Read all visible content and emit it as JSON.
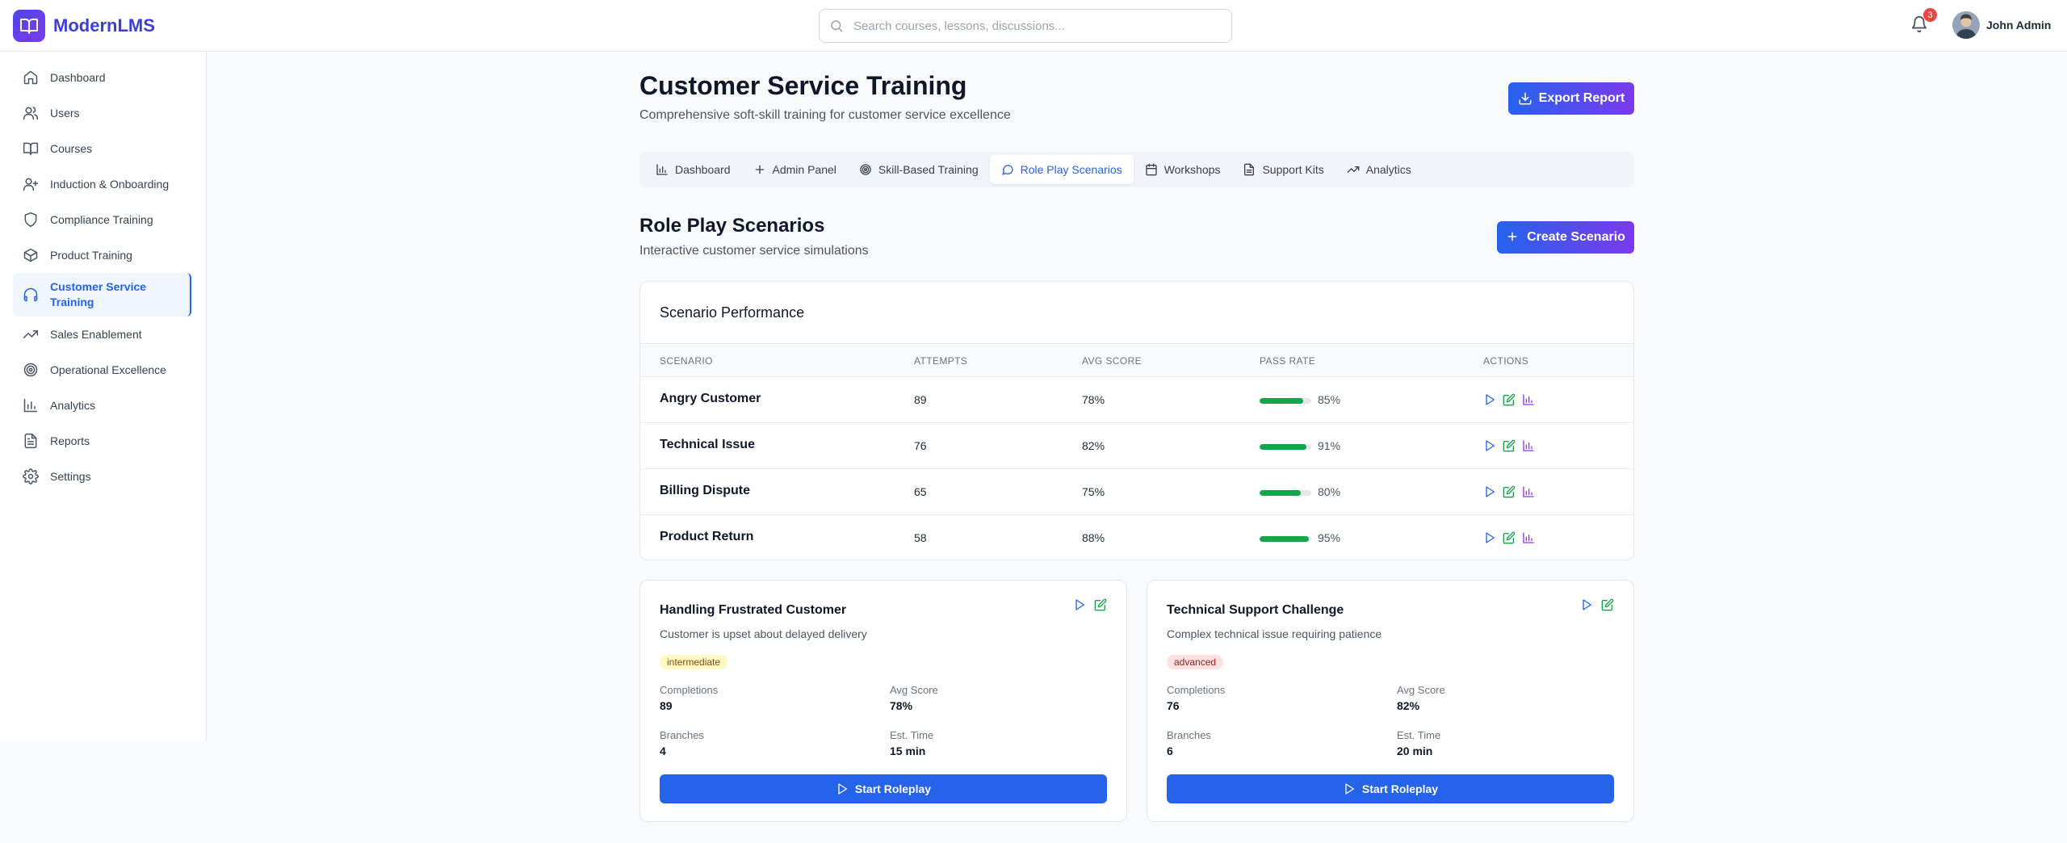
{
  "app": {
    "name": "ModernLMS",
    "logo_icon": "book-open-icon"
  },
  "search": {
    "placeholder": "Search courses, lessons, discussions..."
  },
  "notifications": {
    "count": "3"
  },
  "user": {
    "name": "John Admin"
  },
  "sidebar": {
    "items": [
      {
        "label": "Dashboard",
        "icon": "home-icon"
      },
      {
        "label": "Users",
        "icon": "users-icon"
      },
      {
        "label": "Courses",
        "icon": "book-icon"
      },
      {
        "label": "Induction & Onboarding",
        "icon": "user-plus-icon"
      },
      {
        "label": "Compliance Training",
        "icon": "shield-icon"
      },
      {
        "label": "Product Training",
        "icon": "package-icon"
      },
      {
        "label": "Customer Service Training",
        "icon": "headphones-icon",
        "active": true
      },
      {
        "label": "Sales Enablement",
        "icon": "trending-up-icon"
      },
      {
        "label": "Operational Excellence",
        "icon": "target-icon"
      },
      {
        "label": "Analytics",
        "icon": "bar-chart-icon"
      },
      {
        "label": "Reports",
        "icon": "file-text-icon"
      },
      {
        "label": "Settings",
        "icon": "gear-icon"
      }
    ]
  },
  "header": {
    "title": "Customer Service Training",
    "subtitle": "Comprehensive soft-skill training for customer service excellence",
    "export_label": "Export Report"
  },
  "tabs": [
    {
      "label": "Dashboard",
      "icon": "chart-bar-icon"
    },
    {
      "label": "Admin Panel",
      "icon": "plus-icon"
    },
    {
      "label": "Skill-Based Training",
      "icon": "target-icon"
    },
    {
      "label": "Role Play Scenarios",
      "icon": "message-circle-icon",
      "active": true
    },
    {
      "label": "Workshops",
      "icon": "calendar-icon"
    },
    {
      "label": "Support Kits",
      "icon": "file-text-icon"
    },
    {
      "label": "Analytics",
      "icon": "trending-up-icon"
    }
  ],
  "section": {
    "title": "Role Play Scenarios",
    "subtitle": "Interactive customer service simulations",
    "create_label": "Create Scenario"
  },
  "performance": {
    "title": "Scenario Performance",
    "columns": [
      "Scenario",
      "Attempts",
      "Avg Score",
      "Pass Rate",
      "Actions"
    ],
    "rows": [
      {
        "scenario": "Angry Customer",
        "attempts": "89",
        "avg_score": "78%",
        "pass_rate": "85%",
        "pass_value": 85
      },
      {
        "scenario": "Technical Issue",
        "attempts": "76",
        "avg_score": "82%",
        "pass_rate": "91%",
        "pass_value": 91
      },
      {
        "scenario": "Billing Dispute",
        "attempts": "65",
        "avg_score": "75%",
        "pass_rate": "80%",
        "pass_value": 80
      },
      {
        "scenario": "Product Return",
        "attempts": "58",
        "avg_score": "88%",
        "pass_rate": "95%",
        "pass_value": 95
      }
    ]
  },
  "cards": [
    {
      "title": "Handling Frustrated Customer",
      "description": "Customer is upset about delayed delivery",
      "level": "intermediate",
      "completions_label": "Completions",
      "completions": "89",
      "avg_label": "Avg Score",
      "avg": "78%",
      "branches_label": "Branches",
      "branches": "4",
      "time_label": "Est. Time",
      "time": "15 min",
      "button": "Start Roleplay"
    },
    {
      "title": "Technical Support Challenge",
      "description": "Complex technical issue requiring patience",
      "level": "advanced",
      "completions_label": "Completions",
      "completions": "76",
      "avg_label": "Avg Score",
      "avg": "82%",
      "branches_label": "Branches",
      "branches": "6",
      "time_label": "Est. Time",
      "time": "20 min",
      "button": "Start Roleplay"
    }
  ],
  "colors": {
    "primary": "#2563eb",
    "accent": "#7c3aed",
    "success": "#16a34a",
    "danger": "#ef4444"
  }
}
